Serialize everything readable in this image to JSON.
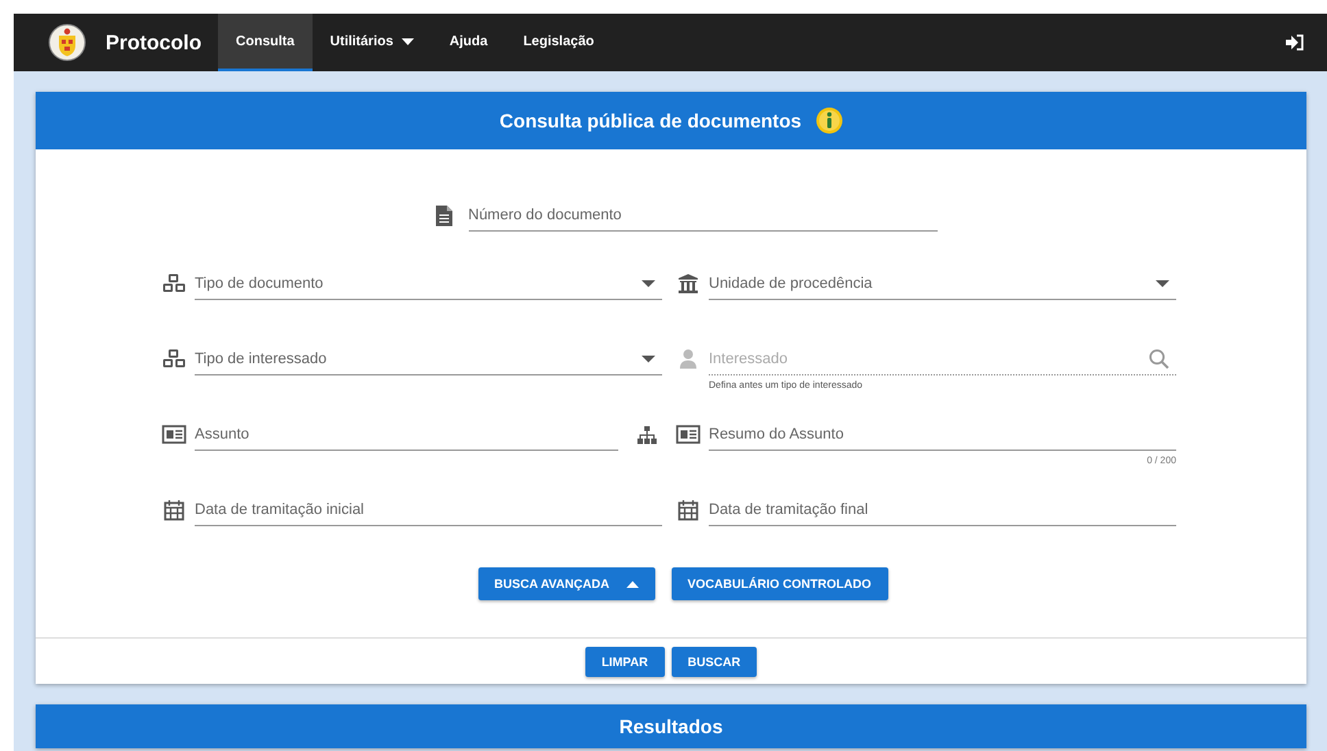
{
  "navbar": {
    "brand": "Protocolo",
    "items": [
      {
        "label": "Consulta",
        "selected": true,
        "dropdown": false
      },
      {
        "label": "Utilitários",
        "selected": false,
        "dropdown": true
      },
      {
        "label": "Ajuda",
        "selected": false,
        "dropdown": false
      },
      {
        "label": "Legislação",
        "selected": false,
        "dropdown": false
      }
    ]
  },
  "search_card": {
    "title": "Consulta pública de documentos",
    "document_number": {
      "placeholder": "Número do documento"
    },
    "fields": [
      {
        "kind": "select",
        "placeholder": "Tipo de documento",
        "disabled": false
      },
      {
        "kind": "select",
        "placeholder": "Unidade de procedência",
        "disabled": false
      },
      {
        "kind": "select",
        "placeholder": "Tipo de interessado",
        "disabled": false
      },
      {
        "kind": "search",
        "placeholder": "Interessado",
        "disabled": true,
        "hint": "Defina antes um tipo de interessado"
      },
      {
        "kind": "text",
        "placeholder": "Assunto",
        "disabled": false,
        "tree_button": true
      },
      {
        "kind": "text",
        "placeholder": "Resumo do Assunto",
        "disabled": false,
        "counter": "0 / 200"
      },
      {
        "kind": "date",
        "placeholder": "Data de tramitação inicial",
        "disabled": false
      },
      {
        "kind": "date",
        "placeholder": "Data de tramitação final",
        "disabled": false
      }
    ],
    "advanced_search": {
      "label": "BUSCA AVANÇADA",
      "expanded": true
    },
    "vocabulary_button": "VOCABULÁRIO CONTROLADO",
    "footer_buttons": [
      "LIMPAR",
      "BUSCAR"
    ]
  },
  "results": {
    "title": "Resultados"
  }
}
